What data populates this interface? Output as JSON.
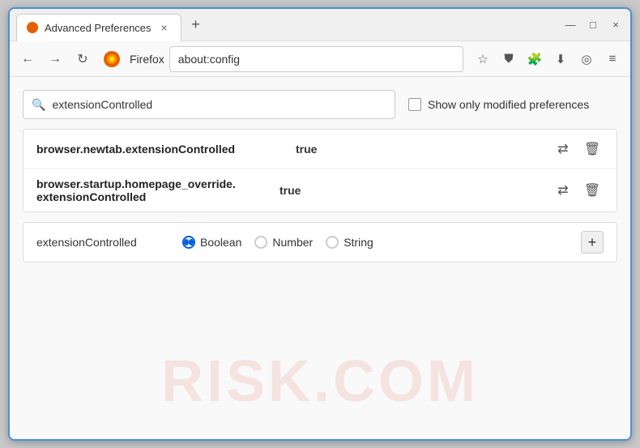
{
  "window": {
    "title": "Advanced Preferences",
    "tab_close": "×",
    "new_tab": "+"
  },
  "window_controls": {
    "minimize": "—",
    "maximize": "□",
    "close": "×"
  },
  "nav": {
    "back": "←",
    "forward": "→",
    "reload": "↻",
    "firefox_label": "Firefox",
    "url": "about:config",
    "bookmark": "☆",
    "shield": "⛊",
    "extension": "🧩",
    "download": "⬇",
    "profile": "◎",
    "menu": "≡"
  },
  "search": {
    "placeholder": "extensionControlled",
    "value": "extensionControlled",
    "show_modified_label": "Show only modified preferences"
  },
  "results": [
    {
      "pref_name": "browser.newtab.extensionControlled",
      "pref_value": "true",
      "multiline": false
    },
    {
      "pref_name_line1": "browser.startup.homepage_override.",
      "pref_name_line2": "extensionControlled",
      "pref_value": "true",
      "multiline": true
    }
  ],
  "add_pref": {
    "name": "extensionControlled",
    "types": [
      {
        "label": "Boolean",
        "selected": true
      },
      {
        "label": "Number",
        "selected": false
      },
      {
        "label": "String",
        "selected": false
      }
    ],
    "add_label": "+"
  },
  "watermark": "RISK.COM",
  "icons": {
    "search": "🔍",
    "reset": "⇄",
    "delete": "🗑"
  }
}
